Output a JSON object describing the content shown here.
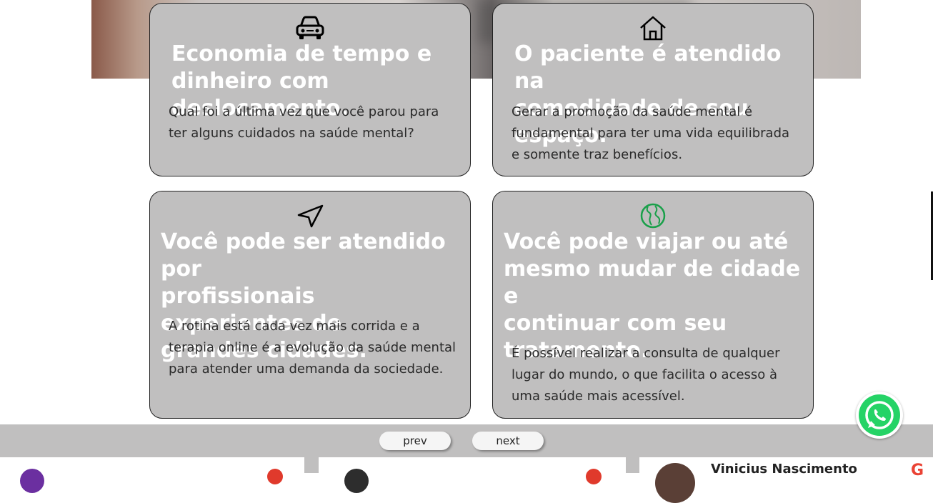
{
  "cards": [
    {
      "icon": "car-icon",
      "title": "Economia de tempo e\ndinheiro com deslocamento.",
      "text": "Qual foi a última vez que você parou para\nter alguns cuidados na saúde mental?"
    },
    {
      "icon": "home-icon",
      "title": "O paciente é atendido na\ncomodidade de seu espaço.",
      "text": "Gerar a promoção da saúde mental é\nfundamental para ter uma vida equilibrada\ne somente traz benefícios."
    },
    {
      "icon": "navigation-arrow-icon",
      "title": "Você pode ser atendido por\nprofissionais experientes de\ngrandes cidades.",
      "text": "A rotina está cada vez mais corrida e a\nterapia online é a evolução da saúde mental\npara atender uma demanda da sociedade."
    },
    {
      "icon": "globe-icon",
      "title": "Você pode viajar ou até\nmesmo mudar de cidade e\ncontinuar com seu\ntratamento.",
      "text": "É possível realizar a consulta de qualquer\nlugar do mundo, o que facilita o acesso à\numa saúde mais acessível."
    }
  ],
  "carousel": {
    "prev_label": "prev",
    "next_label": "next"
  },
  "reviews": {
    "third_name": "Vinicius Nascimento"
  },
  "colors": {
    "card_bg": "#c0bfbf",
    "whatsapp": "#25d366",
    "globe": "#1aa04a"
  }
}
